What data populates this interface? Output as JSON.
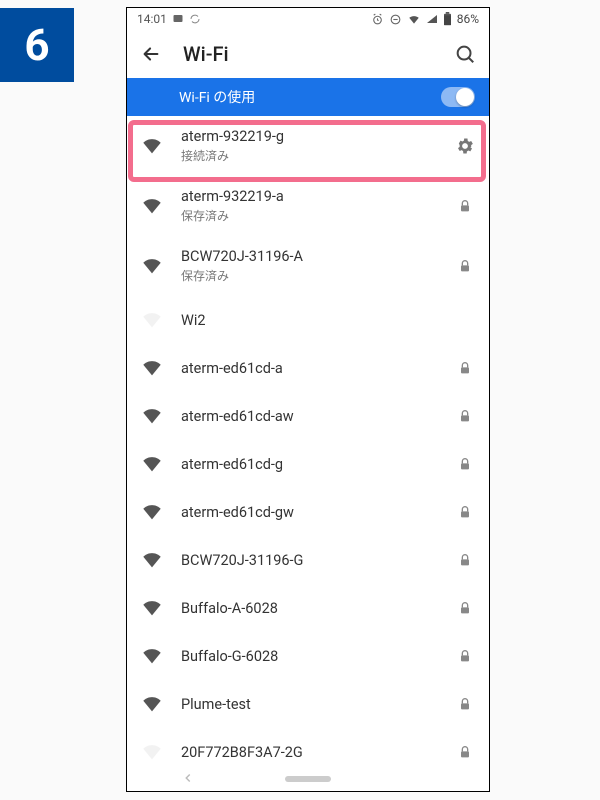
{
  "step_number": "6",
  "status_bar": {
    "time": "14:01",
    "battery": "86%"
  },
  "header": {
    "title": "Wi-Fi"
  },
  "wifi_switch": {
    "label": "Wi-Fi の使用"
  },
  "networks": [
    {
      "ssid": "aterm-932219-g",
      "sub": "接続済み",
      "right": "gear",
      "highlighted": true,
      "strength": "full"
    },
    {
      "ssid": "aterm-932219-a",
      "sub": "保存済み",
      "right": "lock",
      "strength": "full"
    },
    {
      "ssid": "BCW720J-31196-A",
      "sub": "保存済み",
      "right": "lock",
      "strength": "full"
    },
    {
      "ssid": "Wi2",
      "sub": "",
      "right": "",
      "strength": "weak"
    },
    {
      "ssid": "aterm-ed61cd-a",
      "sub": "",
      "right": "lock",
      "strength": "full"
    },
    {
      "ssid": "aterm-ed61cd-aw",
      "sub": "",
      "right": "lock",
      "strength": "full"
    },
    {
      "ssid": "aterm-ed61cd-g",
      "sub": "",
      "right": "lock",
      "strength": "full"
    },
    {
      "ssid": "aterm-ed61cd-gw",
      "sub": "",
      "right": "lock",
      "strength": "full"
    },
    {
      "ssid": "BCW720J-31196-G",
      "sub": "",
      "right": "lock",
      "strength": "full"
    },
    {
      "ssid": "Buffalo-A-6028",
      "sub": "",
      "right": "lock",
      "strength": "full"
    },
    {
      "ssid": "Buffalo-G-6028",
      "sub": "",
      "right": "lock",
      "strength": "full"
    },
    {
      "ssid": "Plume-test",
      "sub": "",
      "right": "lock",
      "strength": "full"
    },
    {
      "ssid": "20F772B8F3A7-2G",
      "sub": "",
      "right": "lock",
      "strength": "weak"
    }
  ]
}
